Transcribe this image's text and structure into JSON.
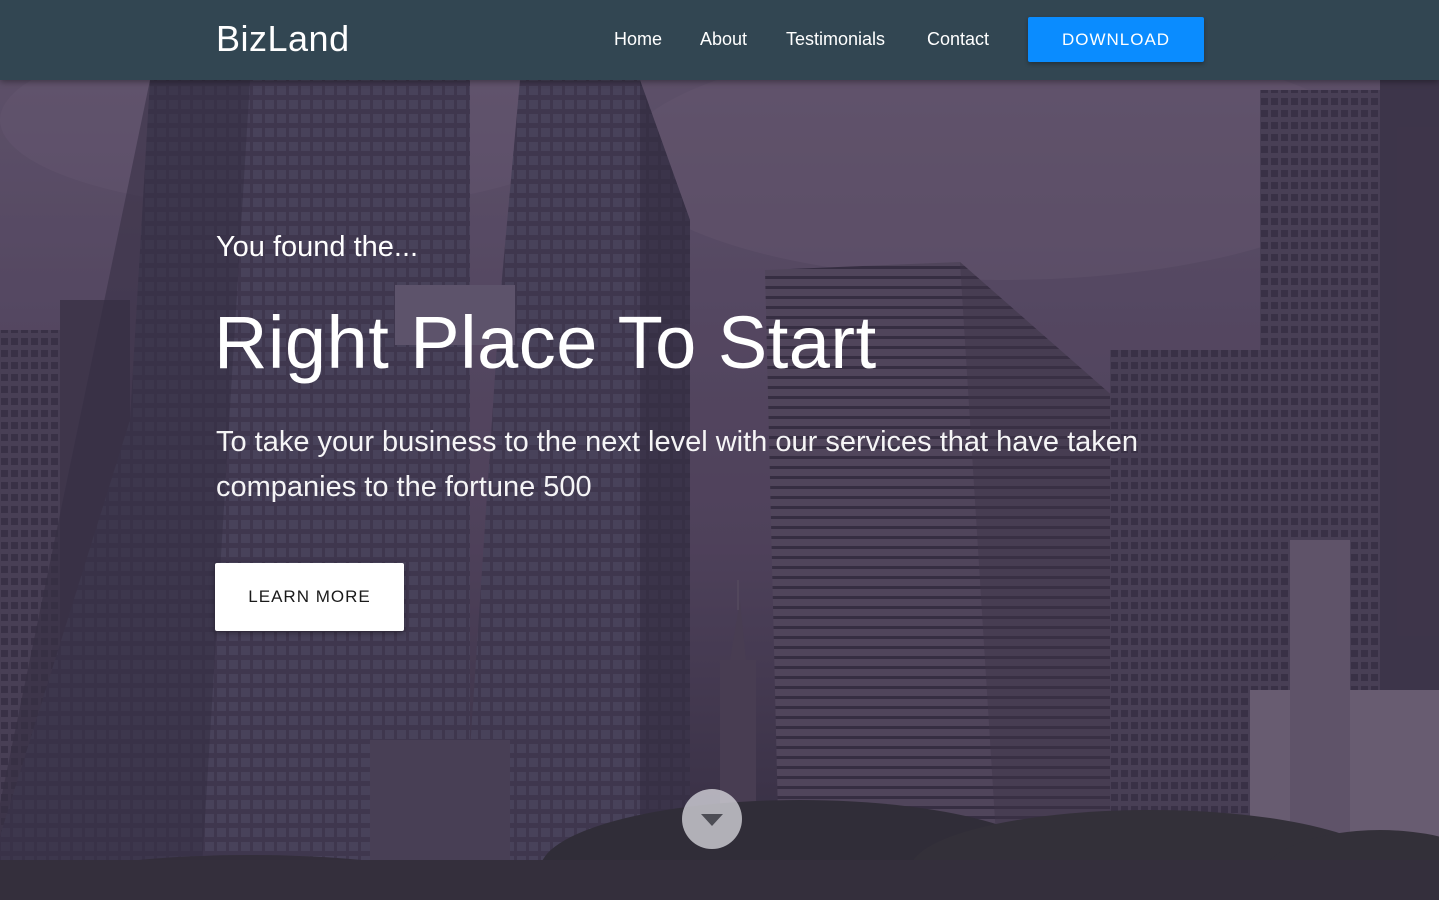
{
  "navbar": {
    "brand": "BizLand",
    "links": [
      {
        "label": "Home"
      },
      {
        "label": "About"
      },
      {
        "label": "Testimonials"
      },
      {
        "label": "Contact"
      }
    ],
    "download_label": "DOWNLOAD"
  },
  "hero": {
    "eyebrow": "You found the...",
    "headline": "Right Place To Start",
    "subtext": "To take your business to the next level with our services that have taken companies to the fortune 500",
    "learn_more_label": "LEARN MORE"
  },
  "icons": {
    "scroll_down": "chevron-down-icon"
  },
  "colors": {
    "navbar_bg": "#324652",
    "accent": "#0a8cff",
    "overlay": "#463452"
  }
}
